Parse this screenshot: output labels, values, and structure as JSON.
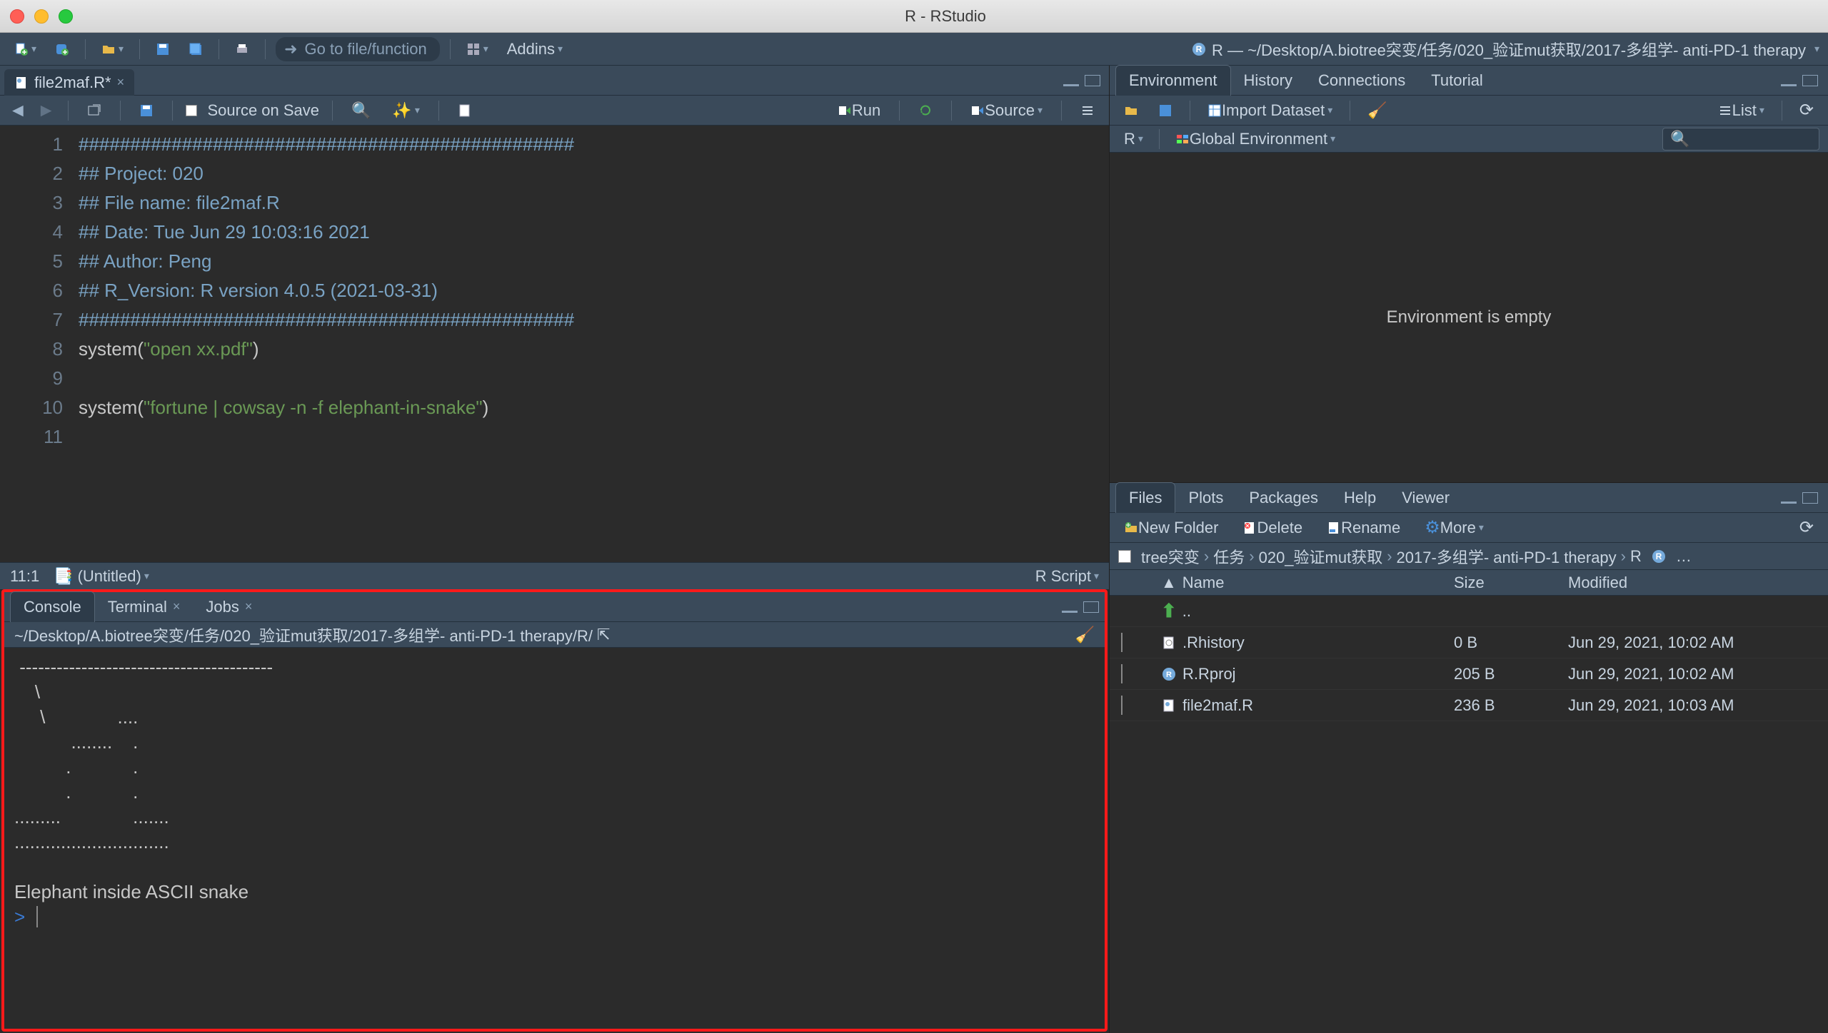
{
  "window": {
    "title": "R - RStudio"
  },
  "main_toolbar": {
    "goto_placeholder": "Go to file/function",
    "addins_label": "Addins",
    "project_label": "R — ~/Desktop/A.biotree突变/任务/020_验证mut获取/2017-多组学- anti-PD-1 therapy"
  },
  "editor": {
    "tab_name": "file2maf.R*",
    "source_on_save": "Source on Save",
    "run_label": "Run",
    "source_label": "Source",
    "lines": [
      "################################################",
      "## Project: 020",
      "## File name: file2maf.R",
      "## Date: Tue Jun 29 10:03:16 2021",
      "## Author: Peng",
      "## R_Version: R version 4.0.5 (2021-03-31)",
      "################################################",
      "system(\"open xx.pdf\")",
      "",
      "system(\"fortune | cowsay -n -f elephant-in-snake\")",
      ""
    ],
    "status_pos": "11:1",
    "status_file": "(Untitled)",
    "status_type": "R Script"
  },
  "console": {
    "tabs": {
      "console": "Console",
      "terminal": "Terminal",
      "jobs": "Jobs"
    },
    "path": "~/Desktop/A.biotree突变/任务/020_验证mut获取/2017-多组学- anti-PD-1 therapy/R/",
    "output": " -----------------------------------------\n    \\\n     \\              ....\n           ........    .\n          .            .\n          .            .\n.........              .......\n..............................\n\nElephant inside ASCII snake",
    "prompt": ">"
  },
  "env_pane": {
    "tabs": {
      "environment": "Environment",
      "history": "History",
      "connections": "Connections",
      "tutorial": "Tutorial"
    },
    "import_label": "Import Dataset",
    "list_label": "List",
    "scope_label": "R",
    "global_env": "Global Environment",
    "empty_msg": "Environment is empty"
  },
  "files_pane": {
    "tabs": {
      "files": "Files",
      "plots": "Plots",
      "packages": "Packages",
      "help": "Help",
      "viewer": "Viewer"
    },
    "toolbar": {
      "new_folder": "New Folder",
      "delete": "Delete",
      "rename": "Rename",
      "more": "More"
    },
    "breadcrumb": [
      "tree突变",
      "任务",
      "020_验证mut获取",
      "2017-多组学- anti-PD-1 therapy",
      "R"
    ],
    "columns": {
      "name": "Name",
      "size": "Size",
      "modified": "Modified"
    },
    "up_dir": "..",
    "rows": [
      {
        "icon": "history-icon",
        "name": ".Rhistory",
        "size": "0 B",
        "modified": "Jun 29, 2021, 10:02 AM"
      },
      {
        "icon": "rproj-icon",
        "name": "R.Rproj",
        "size": "205 B",
        "modified": "Jun 29, 2021, 10:02 AM"
      },
      {
        "icon": "rfile-icon",
        "name": "file2maf.R",
        "size": "236 B",
        "modified": "Jun 29, 2021, 10:03 AM"
      }
    ]
  }
}
